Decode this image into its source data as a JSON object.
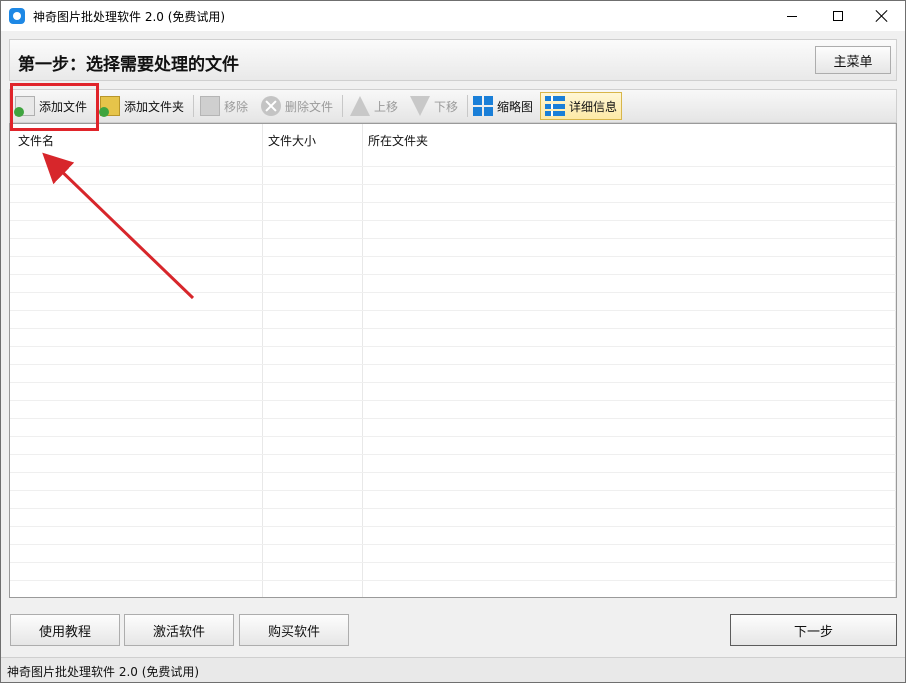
{
  "window": {
    "title": "神奇图片批处理软件 2.0 (免费试用)"
  },
  "header": {
    "step_title": "第一步：选择需要处理的文件",
    "main_menu_label": "主菜单"
  },
  "toolbar": {
    "add_file": "添加文件",
    "add_folder": "添加文件夹",
    "remove": "移除",
    "delete_file": "删除文件",
    "move_up": "上移",
    "move_down": "下移",
    "thumbnail": "缩略图",
    "detail": "详细信息"
  },
  "list": {
    "columns": [
      "文件名",
      "文件大小",
      "所在文件夹"
    ]
  },
  "bottom": {
    "tutorial": "使用教程",
    "activate": "激活软件",
    "buy": "购买软件",
    "next": "下一步"
  },
  "status": {
    "text": "神奇图片批处理软件 2.0 (免费试用)"
  },
  "colors": {
    "highlight": "#e0242a",
    "accent": "#1a7fd8"
  }
}
